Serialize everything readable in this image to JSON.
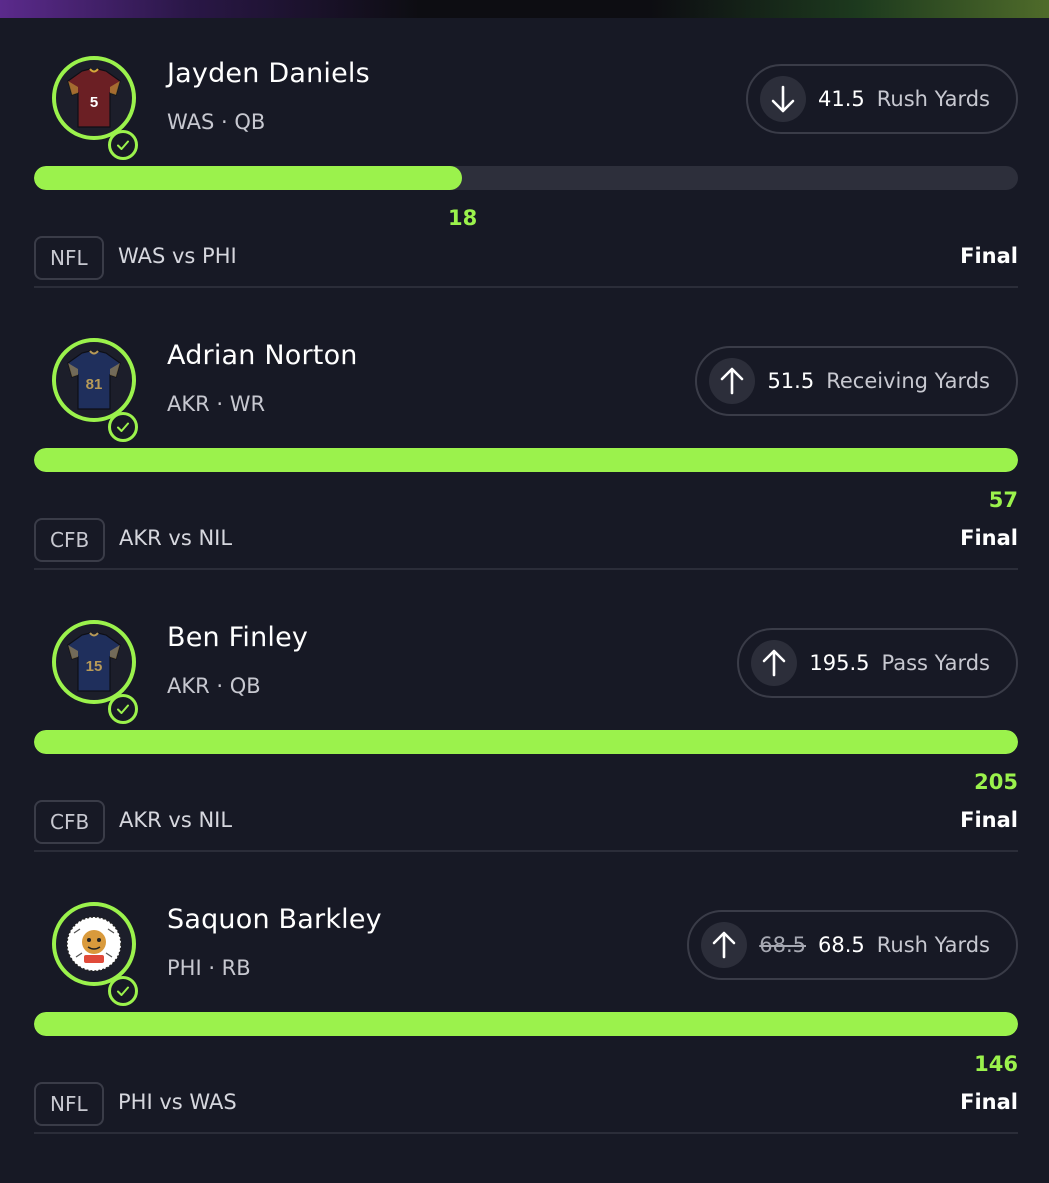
{
  "picks": [
    {
      "name": "Jayden Daniels",
      "meta": "WAS · QB",
      "direction": "down",
      "old_line": "",
      "line": "41.5",
      "stat": "Rush Yards",
      "actual": "18",
      "progress_fraction": 0.435,
      "league": "NFL",
      "matchup": "WAS vs PHI",
      "status": "Final",
      "avatar": "jersey-icon",
      "jersey_number": "5",
      "jersey_color": "#6b1f24",
      "jersey_trim": "#d6a93a"
    },
    {
      "name": "Adrian Norton",
      "meta": "AKR · WR",
      "direction": "up",
      "old_line": "",
      "line": "51.5",
      "stat": "Receiving Yards",
      "actual": "57",
      "progress_fraction": 1.0,
      "league": "CFB",
      "matchup": "AKR vs NIL",
      "status": "Final",
      "avatar": "jersey-icon",
      "jersey_number": "81",
      "jersey_color": "#1f2f5c",
      "jersey_trim": "#b79a58"
    },
    {
      "name": "Ben Finley",
      "meta": "AKR · QB",
      "direction": "up",
      "old_line": "",
      "line": "195.5",
      "stat": "Pass Yards",
      "actual": "205",
      "progress_fraction": 1.0,
      "league": "CFB",
      "matchup": "AKR vs NIL",
      "status": "Final",
      "avatar": "jersey-icon",
      "jersey_number": "15",
      "jersey_color": "#1f2f5c",
      "jersey_trim": "#b79a58"
    },
    {
      "name": "Saquon Barkley",
      "meta": "PHI · RB",
      "direction": "up",
      "old_line": "68.5",
      "line": "68.5",
      "stat": "Rush Yards",
      "actual": "146",
      "progress_fraction": 1.0,
      "league": "NFL",
      "matchup": "PHI vs WAS",
      "status": "Final",
      "avatar": "sticker-icon",
      "jersey_number": "",
      "jersey_color": "#ffffff",
      "jersey_trim": "#e04a3a"
    }
  ],
  "colors": {
    "accent": "#9bf24c",
    "background": "#171925",
    "track": "#2d2f3b",
    "border": "#3a3c48"
  }
}
